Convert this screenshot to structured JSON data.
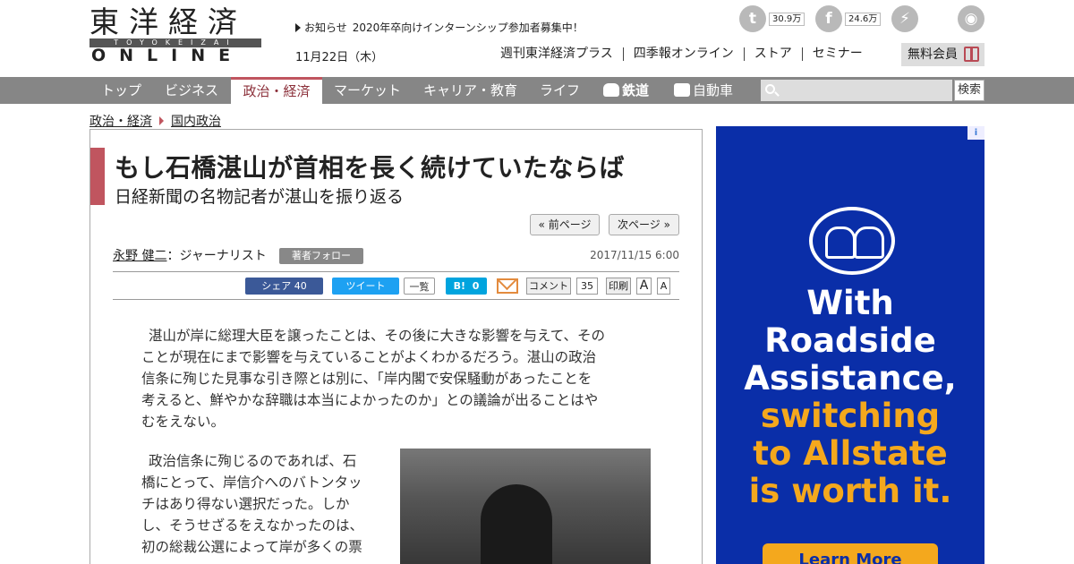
{
  "logo": {
    "kanji": "東洋経済",
    "romaji": "TOYOKEIZAI",
    "online": "ONLINE"
  },
  "header": {
    "notice_label": "お知らせ",
    "notice_text": "2020年卒向けインターンシップ参加者募集中！",
    "date": "11月22日（木）",
    "links": [
      "週刊東洋経済プラス",
      "四季報オンライン",
      "ストア",
      "セミナー"
    ],
    "member_button": "無料会員",
    "social": [
      {
        "icon": "twitter-icon",
        "count": "30.9万"
      },
      {
        "icon": "facebook-icon",
        "count": "24.6万"
      },
      {
        "icon": "messenger-icon"
      },
      {
        "icon": "rss-icon"
      }
    ]
  },
  "nav": {
    "items": [
      "トップ",
      "ビジネス",
      "政治・経済",
      "マーケット",
      "キャリア・教育",
      "ライフ",
      "鉄道",
      "自動車"
    ],
    "active": "政治・経済",
    "search_button": "検索"
  },
  "breadcrumb": [
    "政治・経済",
    "国内政治"
  ],
  "article": {
    "title": "もし石橋湛山が首相を長く続けていたならば",
    "subtitle": "日経新聞の名物記者が湛山を振り返る",
    "prev_page": "« 前ページ",
    "next_page": "次ページ »",
    "author_name": "永野 健二",
    "author_role": "：ジャーナリスト",
    "follow_button": "著者フォロー",
    "published": "2017/11/15 6:00",
    "share": {
      "facebook": "シェア",
      "facebook_count": "40",
      "tweet": "ツイート",
      "list": "一覧",
      "hatena": "B!",
      "hatena_count": "0",
      "comment": "コメント",
      "comment_count": "35",
      "print": "印刷",
      "font_large": "A",
      "font_small": "A"
    },
    "para1_lines": [
      "湛山が岸に総理大臣を譲ったことは、その後に大きな影響を与えて、その",
      "ことが現在にまで影響を与えていることがよくわかるだろう。湛山の政治",
      "信条に殉じた見事な引き際とは別に、「岸内閣で安保騒動があったことを",
      "考えると、鮮やかな辞職は本当によかったのか」との議論が出ることはや",
      "むをえない。"
    ],
    "para2_lines": [
      "政治信条に殉じるのであれば、石",
      "橋にとって、岸信介へのバトンタッ",
      "チはあり得ない選択だった。しか",
      "し、そうせざるをえなかったのは、",
      "初の総裁公選によって岸が多くの票"
    ]
  },
  "ad": {
    "logo_icon": "allstate-hands-icon",
    "line1": "With",
    "line2": "Roadside",
    "line3": "Assistance,",
    "line4": "switching",
    "line5": "to Allstate",
    "line6": "is worth it.",
    "button": "Learn More",
    "badge": "i",
    "colors": {
      "bg": "#0a2ea8",
      "accent": "#f4a81d"
    }
  }
}
